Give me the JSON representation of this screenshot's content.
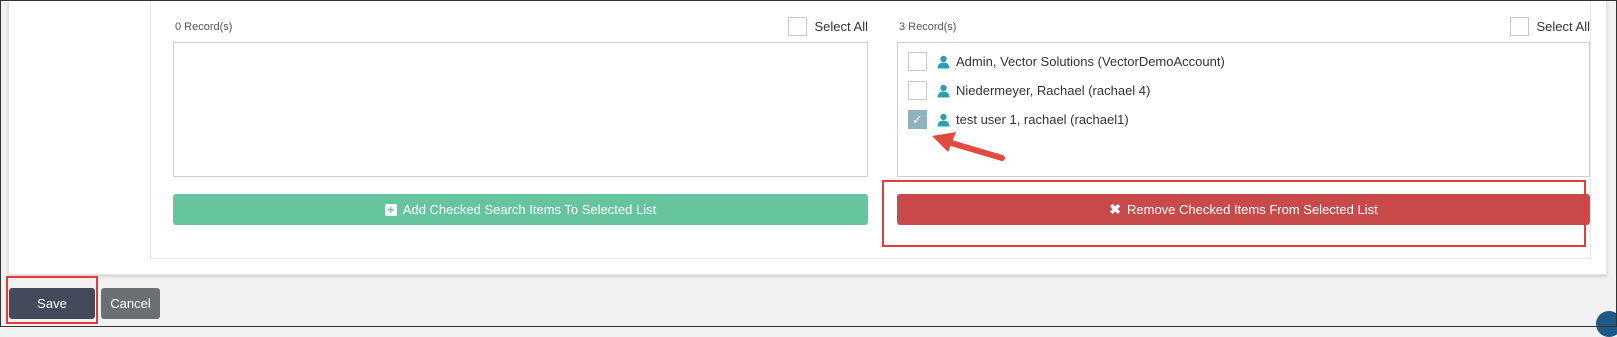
{
  "left_panel": {
    "record_count": "0 Record(s)",
    "select_all_label": "Select All",
    "items": [],
    "add_button_label": "Add Checked Search Items To Selected List"
  },
  "right_panel": {
    "record_count": "3 Record(s)",
    "select_all_label": "Select All",
    "items": [
      {
        "label": "Admin, Vector Solutions (VectorDemoAccount)",
        "checked": false
      },
      {
        "label": "Niedermeyer, Rachael (rachael 4)",
        "checked": false
      },
      {
        "label": "test user 1, rachael (rachael1)",
        "checked": true
      }
    ],
    "remove_button_label": "Remove Checked Items From Selected List"
  },
  "footer": {
    "save_label": "Save",
    "cancel_label": "Cancel"
  },
  "colors": {
    "add_button": "#66c59d",
    "remove_button": "#c84a4a",
    "save_button": "#444a5c",
    "cancel_button": "#6a6f74",
    "highlight": "#e23b3b",
    "user_icon": "#2a9fb4"
  },
  "icons": [
    "user-icon",
    "plus-square-icon",
    "times-icon",
    "check-icon",
    "annotation-arrow-icon"
  ]
}
